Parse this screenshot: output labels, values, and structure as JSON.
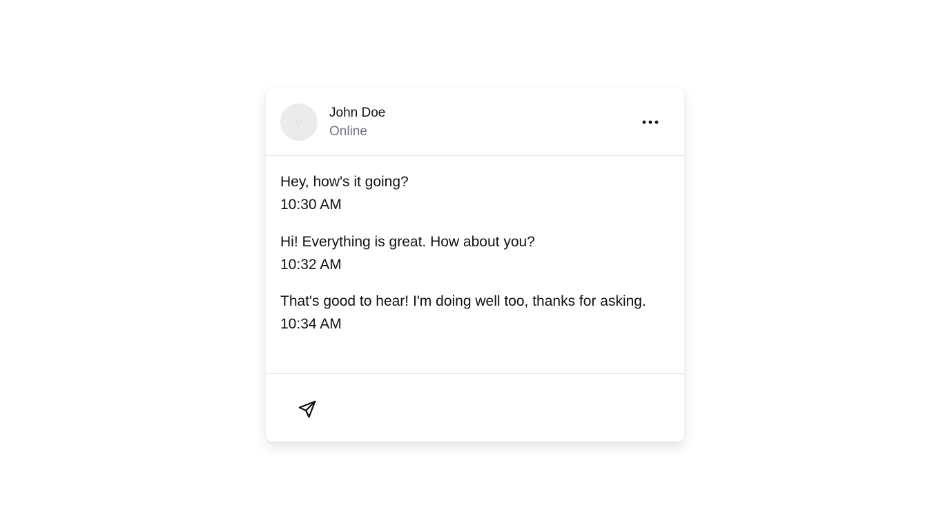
{
  "header": {
    "contact_name": "John Doe",
    "contact_status": "Online",
    "more_icon": "more-horizontal-icon"
  },
  "messages": [
    {
      "text": "Hey, how's it going?",
      "time": "10:30 AM"
    },
    {
      "text": "Hi! Everything is great. How about you?",
      "time": "10:32 AM"
    },
    {
      "text": "That's good to hear! I'm doing well too, thanks for asking.",
      "time": "10:34 AM"
    }
  ],
  "composer": {
    "send_icon": "send-icon"
  },
  "colors": {
    "text": "#111111",
    "status": "#6b7280",
    "avatar_bg": "#ebebeb",
    "divider": "#e2e2e2"
  }
}
